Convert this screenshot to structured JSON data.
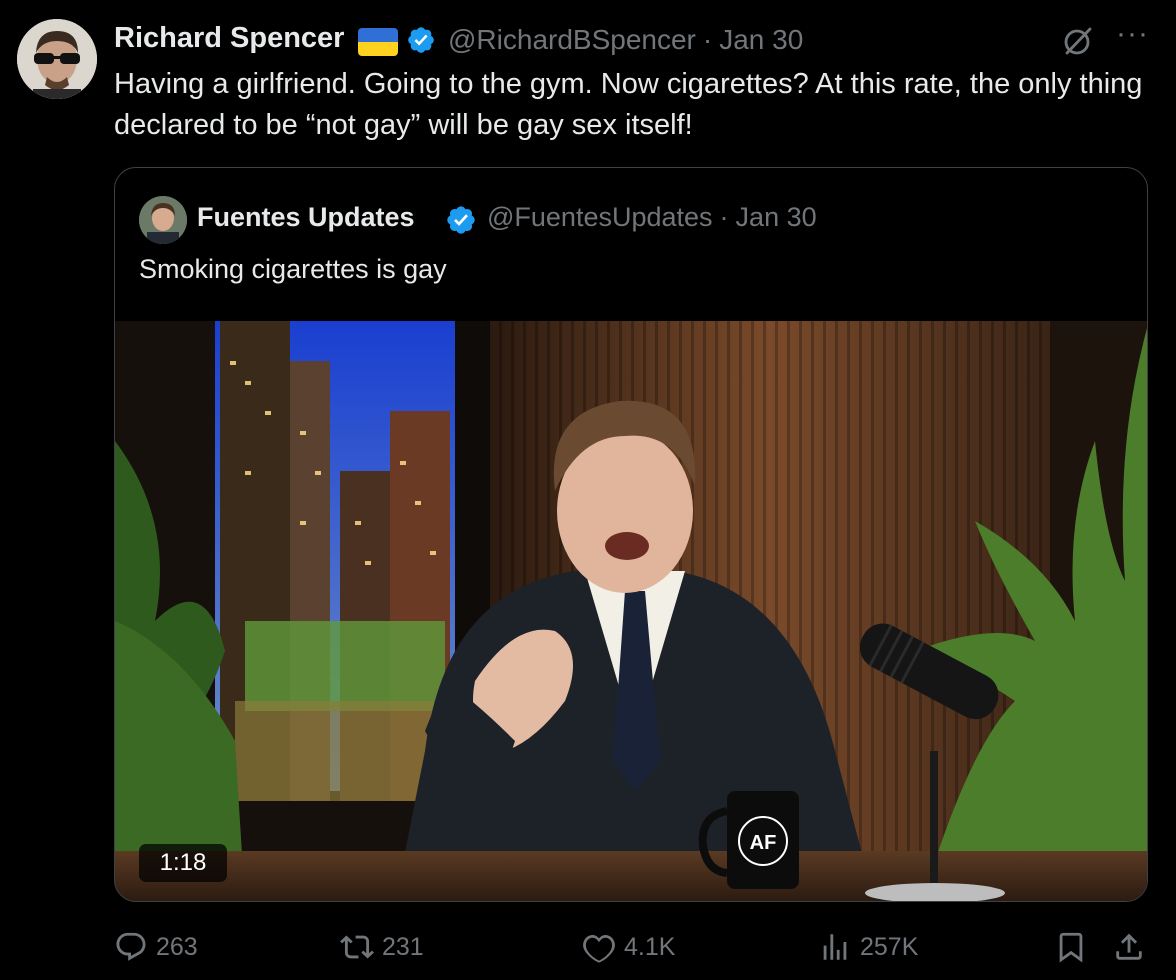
{
  "tweet": {
    "author": {
      "name": "Richard Spencer",
      "handle": "@RichardBSpencer",
      "date": "Jan 30",
      "flag_colors": [
        "#2f6fd6",
        "#ffd21f"
      ]
    },
    "separator": "·",
    "text": "Having a girlfriend. Going to the gym. Now cigarettes? At this rate, the only thing declared to be “not gay” will be gay sex itself!",
    "more_label": "···"
  },
  "quote": {
    "author": {
      "name": "Fuentes Updates",
      "handle": "@FuentesUpdates",
      "date": "Jan 30"
    },
    "text": "Smoking cigarettes is gay",
    "video": {
      "duration": "1:18",
      "mug_logo": "AF"
    }
  },
  "actions": {
    "replies": "263",
    "reposts": "231",
    "likes": "4.1K",
    "views": "257K"
  },
  "colors": {
    "background": "#000000",
    "text_primary": "#e7e9ea",
    "text_secondary": "#71767b",
    "verified_blue": "#1d9bf0",
    "border": "#3e4144"
  },
  "icons": [
    "grok-icon",
    "more-icon",
    "verified-icon",
    "reply-icon",
    "repost-icon",
    "like-icon",
    "views-icon",
    "bookmark-icon",
    "share-icon"
  ]
}
